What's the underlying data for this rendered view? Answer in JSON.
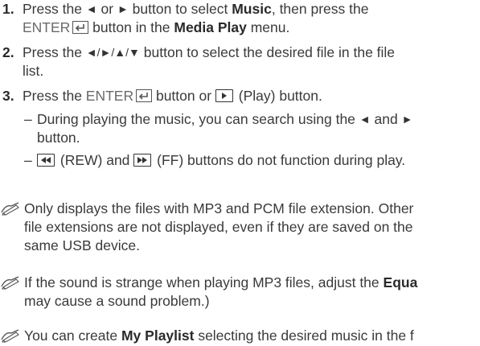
{
  "steps": [
    {
      "number": "1.",
      "line1_a": "Press the ",
      "left_arrow": "◄",
      "line1_b": " or ",
      "right_arrow": "►",
      "line1_c": " button to select ",
      "line1_bold": "Music",
      "line1_d": ", then press the",
      "line2_enter": "ENTER",
      "line2_a": " button in the ",
      "line2_bold": "Media Play",
      "line2_b": " menu."
    },
    {
      "number": "2.",
      "line1_a": "Press the ",
      "arrows": "◄/►/▲/▼",
      "line1_b": " button to select the desired file in the file",
      "line2": "list."
    },
    {
      "number": "3.",
      "line1_a": "Press the ",
      "enter": "ENTER",
      "line1_b": " button or ",
      "line1_c": " (Play) button.",
      "sub_items": [
        {
          "dash": "–",
          "line1_a": "During playing the music, you can search using the ",
          "left_arrow": "◄",
          "line1_b": " and ",
          "right_arrow": "►",
          "line2": "button."
        },
        {
          "dash": "–",
          "text_a": " (REW) and ",
          "text_b": " (FF) buttons do not function during play."
        }
      ]
    }
  ],
  "notes": [
    {
      "line1": "Only displays the files with MP3 and PCM file extension. Other",
      "line2": "file extensions are not displayed, even if they are saved on the",
      "line3": "same USB device."
    },
    {
      "line1_a": "If the sound is strange when playing MP3 files, adjust the ",
      "line1_bold": "Equa",
      "line2": "may cause a sound problem.)"
    },
    {
      "line1_a": "You can create ",
      "line1_bold": "My Playlist",
      "line1_b": " selecting the desired music in the f"
    }
  ],
  "icons": {
    "note_icon": "pencil-note-icon",
    "enter_icon": "enter-return-icon",
    "play_icon": "play-button-icon",
    "rew_icon": "rewind-button-icon",
    "ff_icon": "fast-forward-button-icon"
  }
}
